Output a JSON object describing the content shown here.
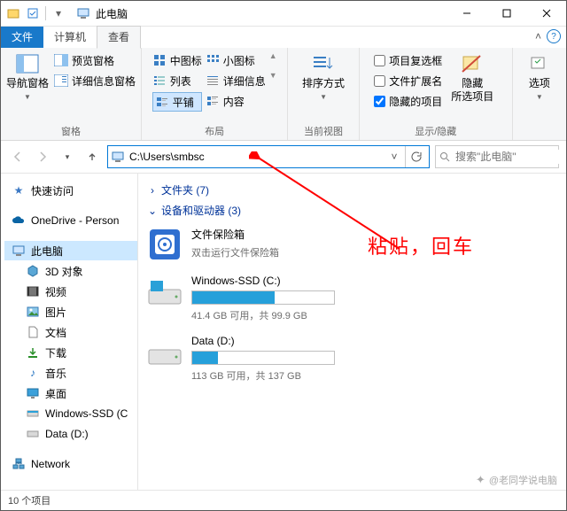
{
  "title": "此电脑",
  "tabs": {
    "file": "文件",
    "computer": "计算机",
    "view": "查看"
  },
  "ribbon": {
    "panes_group": "窗格",
    "nav_pane": "导航窗格",
    "preview_pane": "预览窗格",
    "details_pane": "详细信息窗格",
    "layout_group": "布局",
    "medium_icons": "中图标",
    "small_icons": "小图标",
    "list": "列表",
    "details": "详细信息",
    "tiles": "平铺",
    "content": "内容",
    "current_view_group": "当前视图",
    "sort_by": "排序方式",
    "show_hide_group": "显示/隐藏",
    "item_checkboxes": "项目复选框",
    "file_ext": "文件扩展名",
    "hidden_items": "隐藏的项目",
    "hide": "隐藏",
    "hide_sub": "所选项目",
    "options": "选项"
  },
  "address": {
    "path": "C:\\Users\\smbsc"
  },
  "search": {
    "placeholder": "搜索\"此电脑\""
  },
  "nav": {
    "quick": "快速访问",
    "onedrive": "OneDrive - Person",
    "thispc": "此电脑",
    "threed": "3D 对象",
    "videos": "视频",
    "pictures": "图片",
    "documents": "文档",
    "downloads": "下载",
    "music": "音乐",
    "desktop": "桌面",
    "cdrive": "Windows-SSD (C",
    "ddrive": "Data (D:)",
    "network": "Network"
  },
  "content": {
    "folders_header": "文件夹 (7)",
    "drives_header": "设备和驱动器 (3)",
    "safebox": {
      "name": "文件保险箱",
      "sub": "双击运行文件保险箱"
    },
    "c": {
      "name": "Windows-SSD (C:)",
      "sub": "41.4 GB 可用，共 99.9 GB",
      "fill": 58
    },
    "d": {
      "name": "Data (D:)",
      "sub": "113 GB 可用，共 137 GB",
      "fill": 18
    }
  },
  "status": {
    "items": "10 个项目"
  },
  "annotation": {
    "text": "粘贴，回车"
  },
  "watermark": "@老同学说电脑"
}
